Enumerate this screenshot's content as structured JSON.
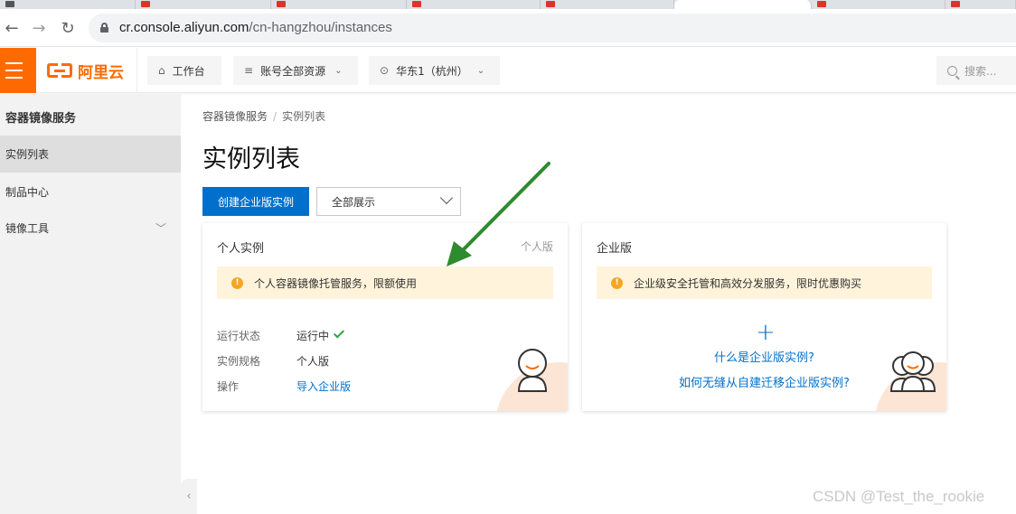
{
  "browser": {
    "url_host": "cr.console.aliyun.com",
    "url_path": "/cn-hangzhou/instances"
  },
  "topbar": {
    "logo_text": "阿里云",
    "workbench_label": "工作台",
    "resources_label": "账号全部资源",
    "region_label": "华东1（杭州）",
    "search_placeholder": "搜索..."
  },
  "sidebar": {
    "title": "容器镜像服务",
    "items": [
      {
        "label": "实例列表"
      },
      {
        "label": "制品中心"
      },
      {
        "label": "镜像工具"
      }
    ]
  },
  "breadcrumb": {
    "root": "容器镜像服务",
    "separator": "/",
    "current": "实例列表"
  },
  "page": {
    "title": "实例列表",
    "create_button": "创建企业版实例",
    "filter_value": "全部展示"
  },
  "personal_card": {
    "title": "个人实例",
    "tag": "个人版",
    "notice": "个人容器镜像托管服务，限额使用",
    "rows": [
      {
        "label": "运行状态",
        "value": "运行中"
      },
      {
        "label": "实例规格",
        "value": "个人版"
      },
      {
        "label": "操作",
        "value": "导入企业版"
      }
    ]
  },
  "enterprise_card": {
    "title": "企业版",
    "notice": "企业级安全托管和高效分发服务，限时优惠购买",
    "link1": "什么是企业版实例?",
    "link2": "如何无缝从自建迁移企业版实例?"
  },
  "watermark": "CSDN @Test_the_rookie",
  "colors": {
    "brand_orange": "#ff6a00",
    "primary_blue": "#0070cc",
    "notice_bg": "#fff4db",
    "annotation_arrow": "#2e8b2e"
  }
}
